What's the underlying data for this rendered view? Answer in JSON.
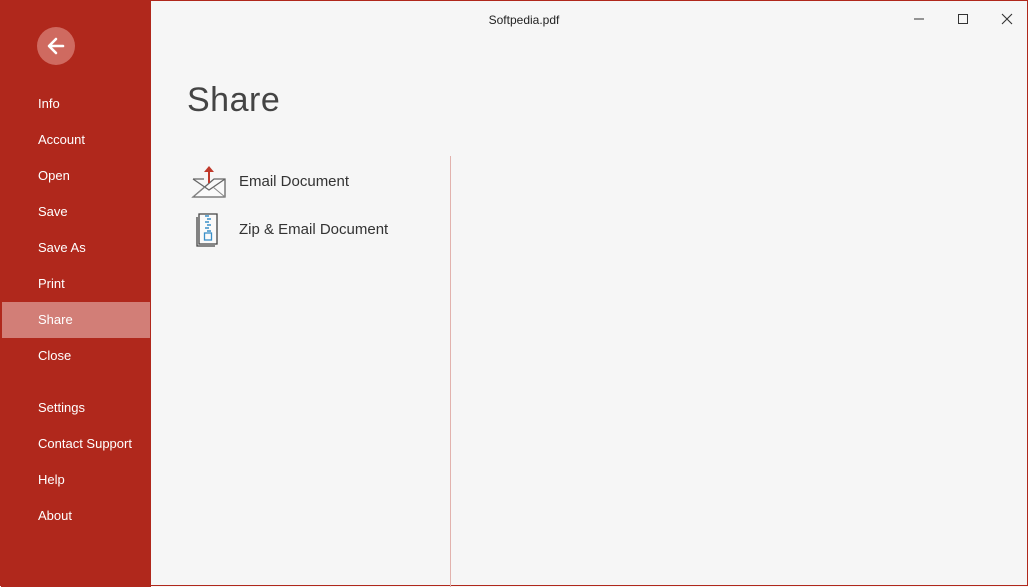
{
  "window": {
    "title": "Softpedia.pdf"
  },
  "sidebar": {
    "items": [
      {
        "label": "Info",
        "active": false
      },
      {
        "label": "Account",
        "active": false
      },
      {
        "label": "Open",
        "active": false
      },
      {
        "label": "Save",
        "active": false
      },
      {
        "label": "Save As",
        "active": false
      },
      {
        "label": "Print",
        "active": false
      },
      {
        "label": "Share",
        "active": true
      },
      {
        "label": "Close",
        "active": false
      },
      {
        "label": "Settings",
        "active": false
      },
      {
        "label": "Contact Support",
        "active": false
      },
      {
        "label": "Help",
        "active": false
      },
      {
        "label": "About",
        "active": false
      }
    ]
  },
  "main": {
    "title": "Share",
    "options": [
      {
        "label": "Email Document",
        "icon": "email-upload-icon"
      },
      {
        "label": "Zip & Email Document",
        "icon": "zip-file-icon"
      }
    ]
  },
  "colors": {
    "accent": "#b0281c",
    "active_item": "#d27e77",
    "background": "#f6f6f6"
  }
}
